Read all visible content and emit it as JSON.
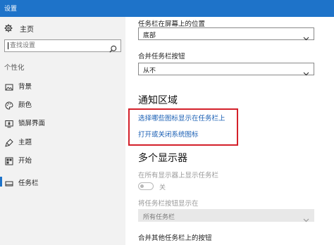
{
  "window": {
    "title": "设置"
  },
  "sidebar": {
    "home_label": "主页",
    "search_placeholder": "查找设置",
    "section_label": "个性化",
    "items": [
      {
        "label": "背景",
        "icon": "image-icon"
      },
      {
        "label": "颜色",
        "icon": "palette-icon"
      },
      {
        "label": "锁屏界面",
        "icon": "lock-screen-icon"
      },
      {
        "label": "主题",
        "icon": "theme-icon"
      },
      {
        "label": "开始",
        "icon": "start-icon"
      },
      {
        "label": "任务栏",
        "icon": "taskbar-icon",
        "active": true
      }
    ]
  },
  "main": {
    "taskbar_position": {
      "label": "任务栏在屏幕上的位置",
      "value": "底部"
    },
    "combine_buttons": {
      "label": "合并任务栏按钮",
      "value": "从不"
    },
    "notification_area": {
      "heading": "通知区域",
      "link1": "选择哪些图标显示在任务栏上",
      "link2": "打开或关闭系统图标"
    },
    "multi_display": {
      "heading": "多个显示器",
      "show_all_label": "在所有显示器上显示任务栏",
      "toggle_state": "关",
      "show_buttons_label": "将任务栏按钮显示在",
      "show_buttons_value": "所有任务栏",
      "combine_other_label": "合并其他任务栏上的按钮"
    }
  },
  "colors": {
    "accent": "#1e73c9",
    "link": "#1a5fb4",
    "highlight_box": "#d4202a"
  }
}
